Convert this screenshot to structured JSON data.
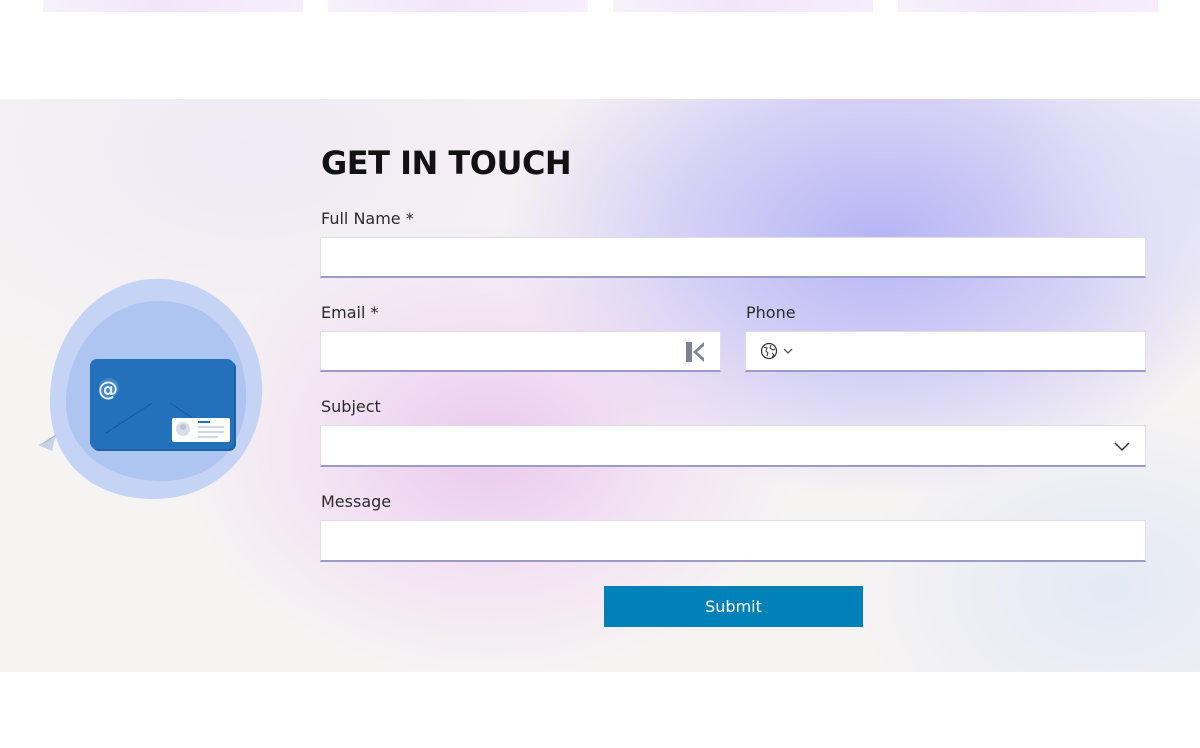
{
  "contact": {
    "title": "GET IN TOUCH",
    "fields": {
      "full_name": {
        "label": "Full Name *",
        "value": "",
        "placeholder": ""
      },
      "email": {
        "label": "Email *",
        "value": "",
        "placeholder": ""
      },
      "phone": {
        "label": "Phone",
        "value": "",
        "placeholder": "",
        "country_icon": "globe-icon"
      },
      "subject": {
        "label": "Subject",
        "value": ""
      },
      "message": {
        "label": "Message",
        "value": "",
        "placeholder": ""
      }
    },
    "submit_label": "Submit"
  },
  "colors": {
    "accent": "#0082b9",
    "illustration_blue": "#1f6db5",
    "blob_blue": "#b3c8f3",
    "heading": "#121212"
  },
  "icons": {
    "email_autofill": "password-manager-icon",
    "phone_country": "globe-icon",
    "phone_dropdown": "chevron-down-icon",
    "subject_dropdown": "chevron-down-icon",
    "illustration": "email-card-illustration"
  }
}
